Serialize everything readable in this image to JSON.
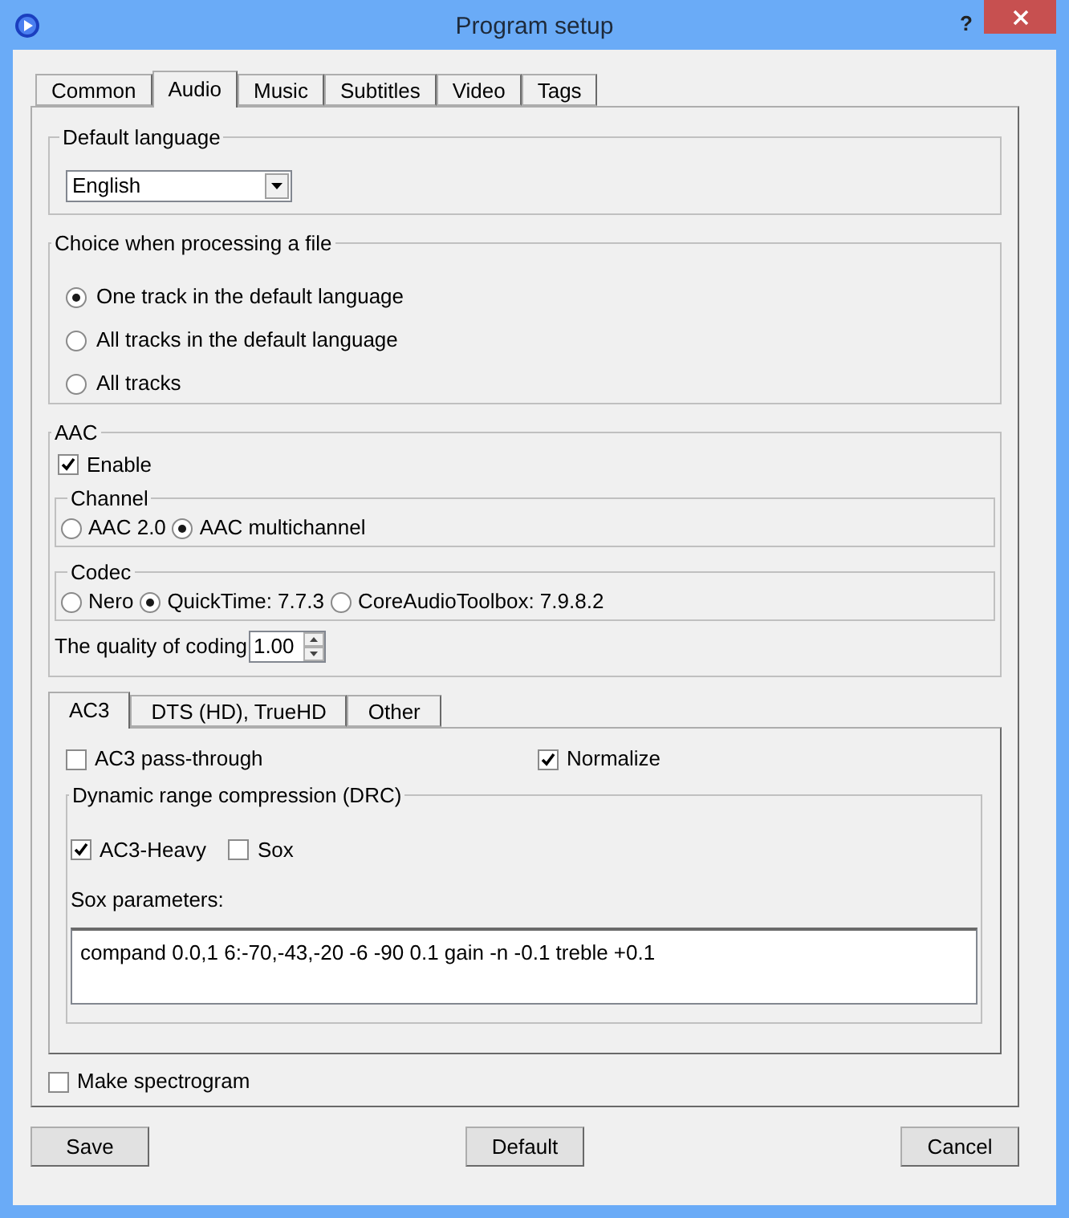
{
  "window": {
    "title": "Program setup",
    "help": "?"
  },
  "tabs": [
    {
      "label": "Common",
      "selected": false
    },
    {
      "label": "Audio",
      "selected": true
    },
    {
      "label": "Music",
      "selected": false
    },
    {
      "label": "Subtitles",
      "selected": false
    },
    {
      "label": "Video",
      "selected": false
    },
    {
      "label": "Tags",
      "selected": false
    }
  ],
  "default_language": {
    "label": "Default language",
    "value": "English"
  },
  "processing_choice": {
    "label": "Choice when processing a file",
    "options": [
      {
        "label": "One track in the default language",
        "selected": true
      },
      {
        "label": "All tracks in the default language",
        "selected": false
      },
      {
        "label": "All tracks",
        "selected": false
      }
    ]
  },
  "aac": {
    "label": "AAC",
    "enable": {
      "label": "Enable",
      "checked": true
    },
    "channel": {
      "label": "Channel",
      "options": [
        {
          "label": "AAC 2.0",
          "selected": false
        },
        {
          "label": "AAC multichannel",
          "selected": true
        }
      ]
    },
    "codec": {
      "label": "Codec",
      "options": [
        {
          "label": "Nero",
          "selected": false
        },
        {
          "label": "QuickTime: 7.7.3",
          "selected": true
        },
        {
          "label": "CoreAudioToolbox: 7.9.8.2",
          "selected": false
        }
      ]
    },
    "quality": {
      "label": "The quality of coding",
      "value": "1.00"
    }
  },
  "subtabs": [
    {
      "label": "AC3",
      "selected": true
    },
    {
      "label": "DTS (HD), TrueHD",
      "selected": false
    },
    {
      "label": "Other",
      "selected": false
    }
  ],
  "ac3": {
    "pass_through": {
      "label": "AC3 pass-through",
      "checked": false
    },
    "normalize": {
      "label": "Normalize",
      "checked": true
    },
    "drc": {
      "label": "Dynamic range compression (DRC)",
      "options": [
        {
          "label": "AC3-Heavy",
          "checked": true
        },
        {
          "label": "Sox",
          "checked": false
        }
      ],
      "sox_label": "Sox parameters:",
      "sox_value": "compand 0.0,1 6:-70,-43,-20 -6 -90 0.1 gain -n -0.1 treble +0.1"
    }
  },
  "spectrogram": {
    "label": "Make spectrogram",
    "checked": false
  },
  "buttons": [
    "Save",
    "Default",
    "Cancel"
  ]
}
